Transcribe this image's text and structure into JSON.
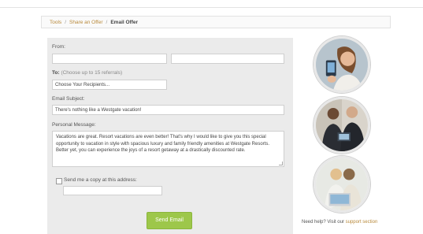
{
  "breadcrumb": {
    "items": [
      "Tools",
      "Share an Offer"
    ],
    "separator": "/",
    "current": "Email Offer"
  },
  "form": {
    "from_label": "From:",
    "to_label": "To:",
    "to_hint": "(Choose up to 15 referrals)",
    "recipients_select": "Choose Your Recipients...",
    "subject_label": "Email Subject:",
    "subject_value": "There's nothing like a Westgate vacation!",
    "message_label": "Personal Message:",
    "message_value": "Vacations are great. Resort vacations are even better! That's why I would like to give you this special opportunity to vacation in style with spacious luxury and family friendly amenities at Westgate Resorts. Better yet, you can experience the joys of a resort getaway at a drastically discounted rate.",
    "copy_label": "Send me a copy at this address:",
    "copy_checked": false,
    "send_button": "Send Email"
  },
  "sidebar": {
    "help_text": "Need help? Visit our",
    "help_link": "support section",
    "photos": [
      "woman-with-phone",
      "business-people-with-tablet",
      "family-with-laptop"
    ]
  },
  "colors": {
    "accent": "#b8893a",
    "button": "#9dc74a",
    "panel": "#ebebeb"
  }
}
